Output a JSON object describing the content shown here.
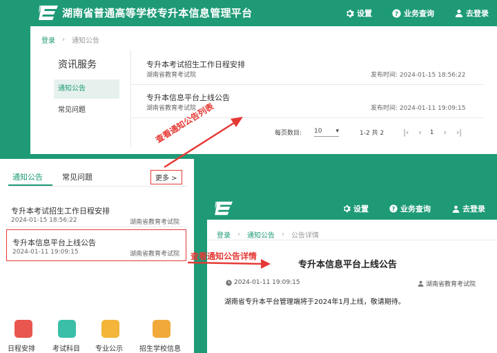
{
  "header": {
    "site_title": "湖南省普通高等学校专升本信息管理平台",
    "settings": "设置",
    "query": "业务查询",
    "login": "去登录"
  },
  "list_page": {
    "breadcrumb": {
      "home": "登录",
      "current": "通知公告"
    },
    "sidebar": {
      "title": "资讯服务",
      "items": [
        {
          "label": "通知公告"
        },
        {
          "label": "常见问题"
        }
      ]
    },
    "notices": [
      {
        "title": "专升本考试招生工作日程安排",
        "source": "湖南省教育考试院",
        "time_label": "发布时间:",
        "time": "2024-01-15 18:56:22"
      },
      {
        "title": "专升本信息平台上线公告",
        "source": "湖南省教育考试院",
        "time_label": "发布时间:",
        "time": "2024-01-11 19:09:15"
      }
    ],
    "pagination": {
      "per_page_label": "每页数目:",
      "per_page": "10",
      "range": "1-2 共 2",
      "page": "1"
    }
  },
  "home_panel": {
    "tabs": [
      {
        "label": "通知公告"
      },
      {
        "label": "常见问题"
      }
    ],
    "more": "更多 >",
    "notices": [
      {
        "title": "专升本考试招生工作日程安排",
        "date": "2024-01-15 18:56:22",
        "source": "湖南省教育考试院"
      },
      {
        "title": "专升本信息平台上线公告",
        "date": "2024-01-11 19:09:15",
        "source": "湖南省教育考试院"
      }
    ],
    "apps": [
      {
        "label": "日程安排",
        "color": "#e8564f"
      },
      {
        "label": "考试科目",
        "color": "#3bbfa8"
      },
      {
        "label": "专业公示",
        "color": "#f3b63b"
      },
      {
        "label": "招生学校信息",
        "color": "#f0a93a"
      }
    ]
  },
  "detail_page": {
    "breadcrumb": {
      "home": "登录",
      "middle": "通知公告",
      "current": "公告详情"
    },
    "title": "专升本信息平台上线公告",
    "date": "2024-01-11 19:09:15",
    "source": "湖南省教育考试院",
    "body": "湖南省专升本平台管理端将于2024年1月上线，敬请期待。"
  },
  "annotations": {
    "list": "查看通知公告列表",
    "detail": "查看通知公告详情"
  },
  "colors": {
    "brand": "#1e9a77",
    "annotation": "#e53935"
  }
}
